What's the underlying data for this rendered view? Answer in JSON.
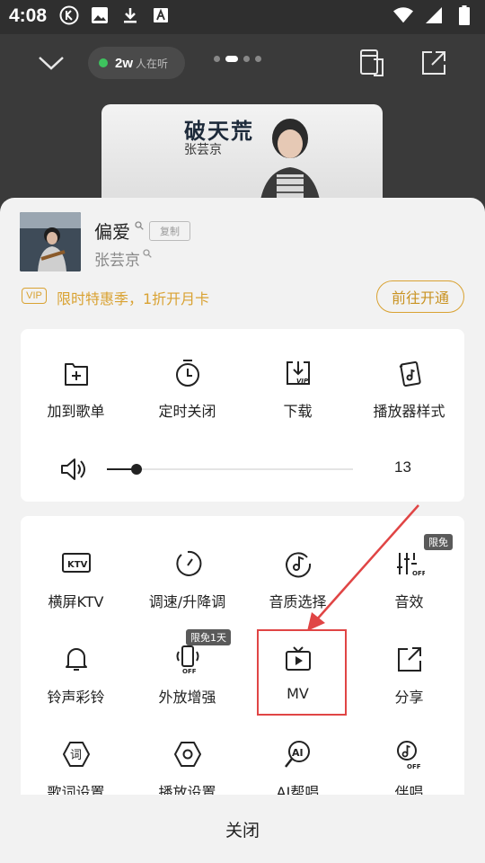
{
  "status_bar": {
    "time": "4:08",
    "left_icons": [
      "k-app-icon",
      "image-icon",
      "download-icon",
      "font-icon"
    ],
    "right_icons": [
      "wifi-icon",
      "signal-icon",
      "battery-icon"
    ]
  },
  "player": {
    "listeners_count": "2w",
    "listeners_label": "人在听",
    "cover_title": "破天荒",
    "cover_artist": "张芸京"
  },
  "song": {
    "title": "偏爱",
    "copy_label": "复制",
    "artist": "张芸京"
  },
  "vip": {
    "badge": "VIP",
    "promo_text": "限时特惠季，1折开月卡",
    "button_label": "前往开通"
  },
  "actions_top": [
    {
      "label": "加到歌单",
      "icon": "add-to-playlist-icon"
    },
    {
      "label": "定时关闭",
      "icon": "timer-icon"
    },
    {
      "label": "下载",
      "icon": "download-vip-icon"
    },
    {
      "label": "播放器样式",
      "icon": "player-style-icon"
    }
  ],
  "volume": {
    "value": "13",
    "level": 0.12
  },
  "actions_grid": [
    {
      "label": "横屏KTV",
      "icon": "ktv-icon"
    },
    {
      "label": "调速/升降调",
      "icon": "speed-dial-icon"
    },
    {
      "label": "音质选择",
      "icon": "audio-quality-icon"
    },
    {
      "label": "音效",
      "icon": "equalizer-icon",
      "tag": "限免"
    },
    {
      "label": "铃声彩铃",
      "icon": "bell-icon"
    },
    {
      "label": "外放增强",
      "icon": "speaker-boost-icon",
      "tag": "限免1天"
    },
    {
      "label": "MV",
      "icon": "mv-tv-icon"
    },
    {
      "label": "分享",
      "icon": "share-icon"
    },
    {
      "label": "歌词设置",
      "icon": "lyrics-icon"
    },
    {
      "label": "播放设置",
      "icon": "playback-settings-icon"
    },
    {
      "label": "AI帮唱",
      "icon": "ai-sing-icon"
    },
    {
      "label": "伴唱",
      "icon": "accompaniment-icon"
    }
  ],
  "close_label": "关闭",
  "colors": {
    "accent_gold": "#d9a232",
    "highlight_red": "#e04545",
    "active_green": "#3ec35e"
  }
}
